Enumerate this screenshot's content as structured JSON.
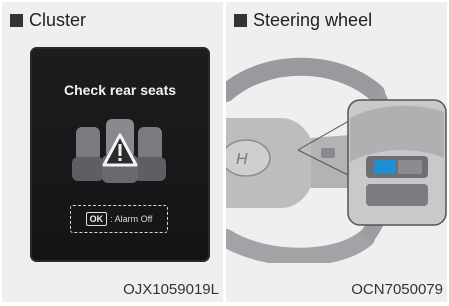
{
  "cluster": {
    "header": "Cluster",
    "message": "Check rear seats",
    "ok_label": "OK",
    "alarm_label": ": Alarm Off",
    "code": "OJX1059019L"
  },
  "steering": {
    "header": "Steering wheel",
    "code": "OCN7050079"
  },
  "colors": {
    "panel_bg": "#efeff0",
    "screen_bg": "#1b1b1d",
    "highlight_button": "#1f8fd1"
  },
  "icons": [
    "warning-triangle-icon",
    "rear-seats-icon"
  ]
}
